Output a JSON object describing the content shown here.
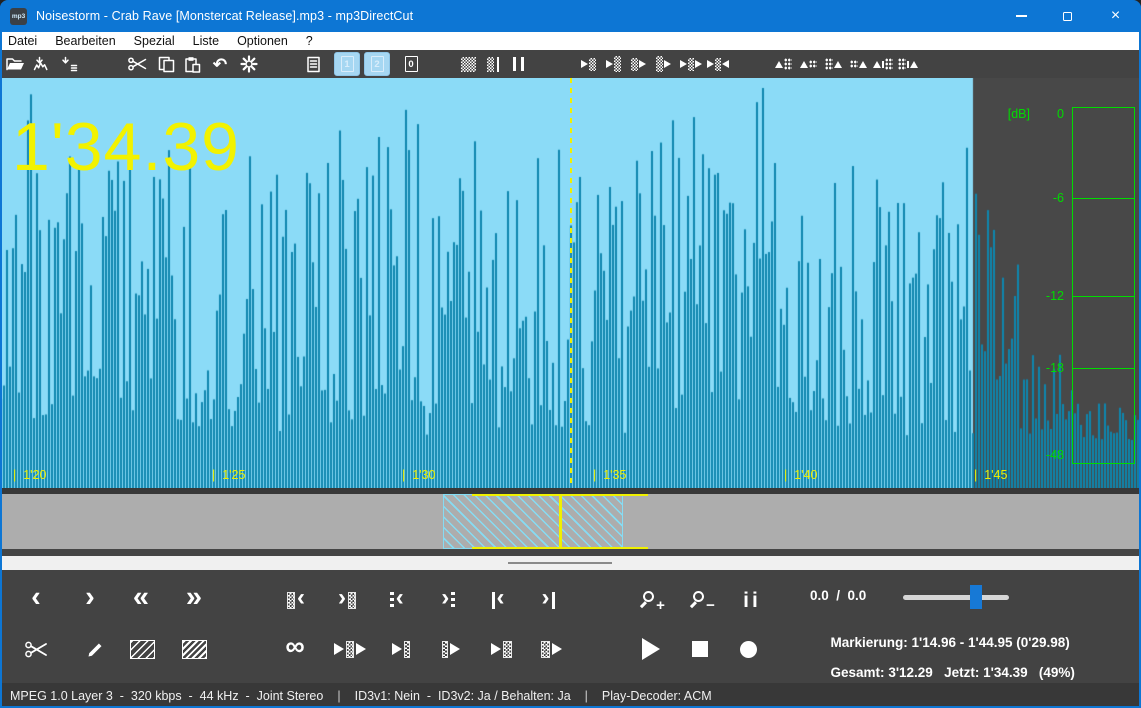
{
  "colors": {
    "titlebar_blue": "#0D76D4",
    "toolbar_gray": "#434343",
    "wave_selected_bg": "#8BDBF7",
    "wave_unselected_bg": "#484848",
    "wave_bar_teal": "#0E86AE",
    "meter_green": "#00DC00",
    "marker_yellow": "#F0F000",
    "navigator_gray": "#ADADAD",
    "slider_blue": "#1779D6"
  },
  "window": {
    "title": "Noisestorm - Crab Rave [Monstercat Release].mp3 - mp3DirectCut",
    "app_icon_text": "mp3"
  },
  "menu": {
    "items": [
      {
        "label": "Datei",
        "name": "datei"
      },
      {
        "label": "Bearbeiten",
        "name": "bearbeiten"
      },
      {
        "label": "Spezial",
        "name": "spezial"
      },
      {
        "label": "Liste",
        "name": "liste"
      },
      {
        "label": "Optionen",
        "name": "optionen"
      },
      {
        "label": "?",
        "name": "hilfe"
      }
    ]
  },
  "toolbar": {
    "buttons": [
      {
        "name": "open-file"
      },
      {
        "name": "save-complete-audio"
      },
      {
        "name": "save-split"
      },
      {
        "name": "cut"
      },
      {
        "name": "copy"
      },
      {
        "name": "paste"
      },
      {
        "name": "undo"
      },
      {
        "name": "settings"
      },
      {
        "name": "file-properties"
      },
      {
        "name": "part-1",
        "toggled": true,
        "label": "1"
      },
      {
        "name": "part-2",
        "toggled": true,
        "label": "2"
      },
      {
        "name": "id3-tag",
        "label": "0"
      },
      {
        "name": "level-view-fine"
      },
      {
        "name": "level-view-coarse"
      },
      {
        "name": "pause-detection"
      },
      {
        "name": "cut-in-step-left"
      },
      {
        "name": "cut-in-step-right"
      },
      {
        "name": "cut-out-step-left"
      },
      {
        "name": "cut-out-step-right"
      },
      {
        "name": "move-selection-left"
      },
      {
        "name": "move-selection-right"
      },
      {
        "name": "fade-in-begin"
      },
      {
        "name": "fade-in-end"
      },
      {
        "name": "fade-out-begin"
      },
      {
        "name": "fade-out-end"
      },
      {
        "name": "gain-decrease"
      },
      {
        "name": "gain-increase"
      }
    ]
  },
  "wave": {
    "time_display": "1'34.39",
    "ruler_labels": [
      "1'20",
      "1'25",
      "1'30",
      "1'35",
      "1'40",
      "1'45"
    ],
    "db_unit": "[dB]",
    "db_ticks": [
      "0",
      "-6",
      "-12",
      "-18",
      "-48"
    ]
  },
  "transport": {
    "row1": [
      {
        "name": "step-back"
      },
      {
        "name": "step-forward"
      },
      {
        "name": "seek-back"
      },
      {
        "name": "seek-forward"
      },
      {
        "name": "goto-cut-in"
      },
      {
        "name": "goto-cut-out"
      },
      {
        "name": "prev-pause"
      },
      {
        "name": "next-pause"
      },
      {
        "name": "goto-start"
      },
      {
        "name": "goto-end"
      },
      {
        "name": "zoom-in"
      },
      {
        "name": "zoom-out"
      },
      {
        "name": "vu-meter"
      }
    ],
    "row2": [
      {
        "name": "cut-selection"
      },
      {
        "name": "edit-id3"
      },
      {
        "name": "mark-cut-in"
      },
      {
        "name": "mark-cut-out"
      },
      {
        "name": "loop-play"
      },
      {
        "name": "play-around-cut"
      },
      {
        "name": "play-to-cut"
      },
      {
        "name": "play-from-cut"
      },
      {
        "name": "preplay-cut-in"
      },
      {
        "name": "postplay-cut-out"
      },
      {
        "name": "play"
      },
      {
        "name": "stop"
      },
      {
        "name": "record"
      }
    ]
  },
  "readout": {
    "speed": "0.0  /  0.0",
    "marker_label": "Markierung:",
    "marker_value": "1'14.96 - 1'44.95 (0'29.98)",
    "total_label": "Gesamt:",
    "total_value": "3'12.29",
    "now_label": "Jetzt:",
    "now_value": "1'34.39",
    "percent": "(49%)"
  },
  "statusbar": {
    "left": "MPEG 1.0 Layer 3  -  320 kbps  -  44 kHz  -  Joint Stereo",
    "id3": "ID3v1: Nein  -  ID3v2: Ja / Behalten: Ja",
    "decoder": "Play-Decoder: ACM",
    "separator": "|"
  }
}
